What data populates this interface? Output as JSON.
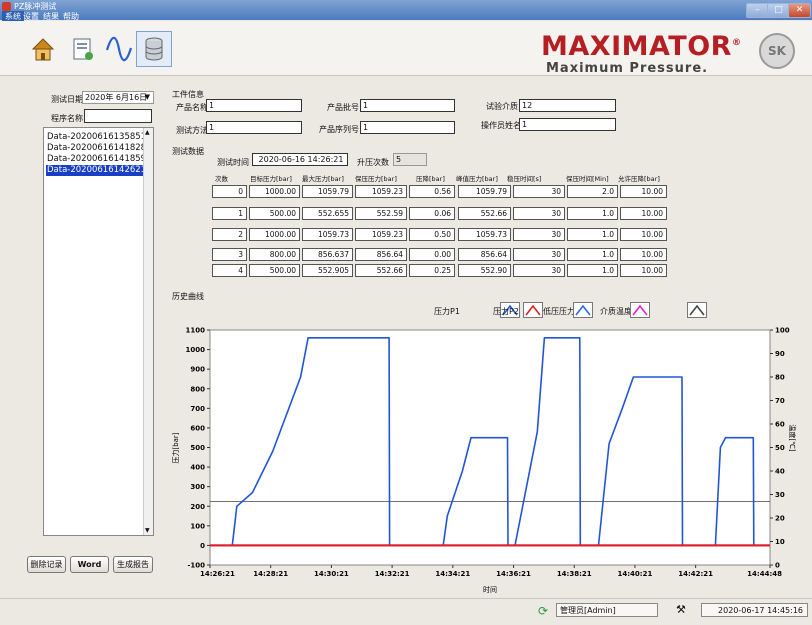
{
  "window": {
    "title": "PZ脉冲测试",
    "min": "–",
    "max": "□",
    "close": "✕"
  },
  "menu": [
    {
      "label": "系统"
    },
    {
      "label": "设置"
    },
    {
      "label": "结果"
    },
    {
      "label": "帮助"
    }
  ],
  "toolbar": {
    "icons": [
      "home-icon",
      "report-icon",
      "curve-icon",
      "database-icon"
    ]
  },
  "brand": {
    "name": "MAXIMATOR",
    "reg": "®",
    "tagline": "Maximum Pressure.",
    "badge": "SK"
  },
  "sidebar": {
    "date_label": "测试日期",
    "date_value": "2020年 6月16日",
    "program_label": "程序名称",
    "program_value": "",
    "items": [
      {
        "label": "Data-20200616135851"
      },
      {
        "label": "Data-20200616141828"
      },
      {
        "label": "Data-20200616141859"
      },
      {
        "label": "Data-20200616142621"
      }
    ],
    "selected_index": 3,
    "buttons": {
      "delete": "删除记录",
      "word": "Word",
      "report": "生成报告"
    }
  },
  "workpiece": {
    "section_title": "工件信息",
    "fields": [
      {
        "label": "产品名称",
        "value": "1"
      },
      {
        "label": "产品批号",
        "value": "1"
      },
      {
        "label": "试验介质",
        "value": "12"
      },
      {
        "label": "测试方法",
        "value": "1"
      },
      {
        "label": "产品序列号",
        "value": "1"
      },
      {
        "label": "操作员姓名",
        "value": "1"
      }
    ]
  },
  "test_data": {
    "section_title": "测试数据",
    "time_label": "测试时间",
    "time_value": "2020-06-16 14:26:21",
    "count_label": "升压次数",
    "count_value": "5",
    "columns": [
      "次数",
      "目标压力[bar]",
      "最大压力[bar]",
      "保压压力[bar]",
      "压降[bar]",
      "峰值压力[bar]",
      "稳压时间[s]",
      "保压时间[Min]",
      "允许压降[bar]"
    ],
    "rows": [
      [
        "0",
        "1000.00",
        "1059.79",
        "1059.23",
        "0.56",
        "1059.79",
        "30",
        "2.0",
        "10.00"
      ],
      [
        "1",
        "500.00",
        "552.655",
        "552.59",
        "0.06",
        "552.66",
        "30",
        "1.0",
        "10.00"
      ],
      [
        "2",
        "1000.00",
        "1059.73",
        "1059.23",
        "0.50",
        "1059.73",
        "30",
        "1.0",
        "10.00"
      ],
      [
        "3",
        "800.00",
        "856.637",
        "856.64",
        "0.00",
        "856.64",
        "30",
        "1.0",
        "10.00"
      ],
      [
        "4",
        "500.00",
        "552.905",
        "552.66",
        "0.25",
        "552.90",
        "30",
        "1.0",
        "10.00"
      ]
    ]
  },
  "history": {
    "section_title": "历史曲线"
  },
  "legend": [
    {
      "label": "压力P1",
      "color": "#2255d6"
    },
    {
      "label": "压力P2",
      "color": "#e02020"
    },
    {
      "label": "低压压力",
      "color": "#2b66e0"
    },
    {
      "label": "介质温度",
      "color": "#e020e0"
    },
    {
      "label": "",
      "color": "#444444"
    }
  ],
  "chart_data": {
    "type": "line",
    "xlabel": "时间",
    "ylabel": "压力[bar]",
    "y2label": "温度[℃]",
    "ylim": [
      -100,
      1100
    ],
    "y2lim": [
      0,
      100
    ],
    "yticks": [
      -100,
      0,
      100,
      200,
      300,
      400,
      500,
      600,
      700,
      800,
      900,
      1000,
      1100
    ],
    "y2ticks": [
      0,
      10,
      20,
      30,
      40,
      50,
      60,
      70,
      80,
      90,
      100
    ],
    "xlim": [
      "14:26:21",
      "14:44:48"
    ],
    "xticks": [
      "14:26:21",
      "14:28:21",
      "14:30:21",
      "14:32:21",
      "14:34:21",
      "14:36:21",
      "14:38:21",
      "14:40:21",
      "14:42:21",
      "14:44:48"
    ],
    "grid": false,
    "series": [
      {
        "name": "压力P1",
        "color": "#2255d6",
        "axis": "left",
        "x": [
          "14:26:21",
          "14:27:05",
          "14:27:14",
          "14:27:45",
          "14:28:25",
          "14:29:20",
          "14:29:35",
          "14:32:15",
          "14:32:16",
          "14:34:02",
          "14:34:10",
          "14:34:40",
          "14:34:57",
          "14:35:00",
          "14:36:09",
          "14:36:10",
          "14:36:24",
          "14:37:08",
          "14:37:22",
          "14:38:32",
          "14:38:33",
          "14:39:09",
          "14:39:30",
          "14:39:56",
          "14:40:18",
          "14:40:50",
          "14:41:54",
          "14:41:55",
          "14:43:00",
          "14:43:10",
          "14:43:20",
          "14:44:15",
          "14:44:16",
          "14:44:48"
        ],
        "y": [
          0,
          0,
          200,
          270,
          480,
          860,
          1060,
          1060,
          0,
          0,
          150,
          380,
          550,
          550,
          550,
          0,
          0,
          580,
          1060,
          1060,
          0,
          0,
          520,
          700,
          860,
          860,
          860,
          0,
          0,
          500,
          550,
          550,
          0,
          0
        ]
      },
      {
        "name": "压力P2",
        "color": "#e02020",
        "axis": "left",
        "x": [
          "14:26:21",
          "14:44:48"
        ],
        "y": [
          0,
          0
        ]
      },
      {
        "name": "介质温度",
        "color": "#e020e0",
        "axis": "left",
        "x": [
          "14:26:21",
          "14:44:48"
        ],
        "y": [
          0,
          0
        ]
      },
      {
        "name": "",
        "color": "#444444",
        "axis": "left",
        "x": [
          "14:26:21",
          "14:44:48"
        ],
        "y": [
          225,
          225
        ]
      }
    ]
  },
  "status": {
    "user": "管理员[Admin]",
    "datetime": "2020-06-17 14:45:16"
  }
}
